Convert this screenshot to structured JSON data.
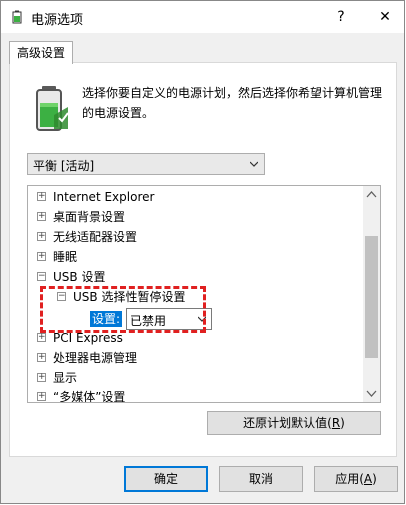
{
  "window": {
    "title": "电源选项",
    "help_label": "?",
    "close_label": "✕"
  },
  "tab": {
    "label": "高级设置"
  },
  "description": {
    "line1": "选择你要自定义的电源计划，然后选择你希望计算机管理",
    "line2": "的电源设置。"
  },
  "plan_select": {
    "value": "平衡 [活动]"
  },
  "tree": {
    "items": [
      {
        "label": "Internet Explorer",
        "expander": "+"
      },
      {
        "label": "桌面背景设置",
        "expander": "+"
      },
      {
        "label": "无线适配器设置",
        "expander": "+"
      },
      {
        "label": "睡眠",
        "expander": "+"
      },
      {
        "label": "USB 设置",
        "expander": "−"
      },
      {
        "label": "USB 选择性暂停设置",
        "expander": "−"
      },
      {
        "label": "PCI Express",
        "expander": "+"
      },
      {
        "label": "处理器电源管理",
        "expander": "+"
      },
      {
        "label": "显示",
        "expander": "+"
      },
      {
        "label": "“多媒体”设置",
        "expander": "+"
      }
    ],
    "setting_label": "设置:",
    "setting_value": "已禁用"
  },
  "restore_button": {
    "label_prefix": "还原计划默认值(",
    "hotkey": "R",
    "label_suffix": ")"
  },
  "buttons": {
    "ok": "确定",
    "cancel": "取消",
    "apply_prefix": "应用(",
    "apply_hotkey": "A",
    "apply_suffix": ")"
  },
  "colors": {
    "selection": "#0078d7",
    "highlight_border": "#e02020",
    "battery_green": "#3cb043"
  },
  "icons": {
    "window": "battery-icon",
    "large": "battery-icon"
  }
}
